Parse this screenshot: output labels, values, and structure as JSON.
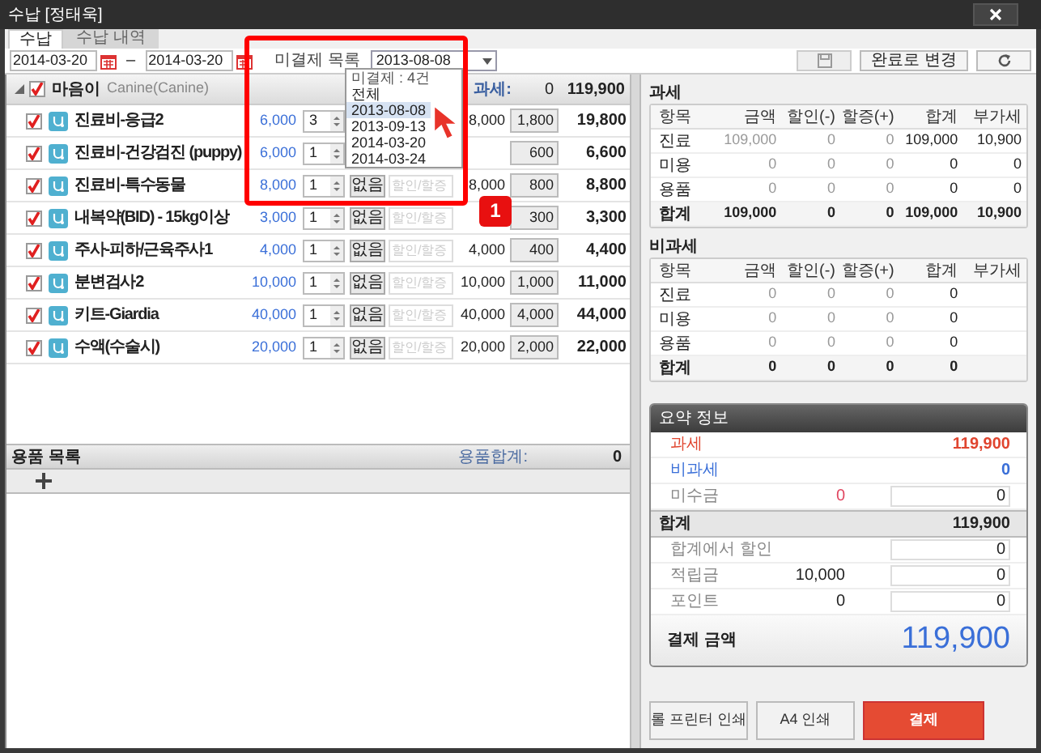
{
  "window": {
    "title": "수납 [정태욱]"
  },
  "tabs": [
    {
      "label": "수납",
      "selected": true
    },
    {
      "label": "수납 내역",
      "selected": false
    }
  ],
  "toolbar": {
    "date_from": "2014-03-20",
    "separator": "–",
    "date_to": "2014-03-20",
    "unpaid_label": "미결제 목록",
    "unpaid_select": "2013-08-08",
    "complete_button": "완료로 변경"
  },
  "dropdown": {
    "options": [
      {
        "label": "미결제 : 4건",
        "kind": "header",
        "selected": false
      },
      {
        "label": "전체",
        "kind": "option",
        "selected": false
      },
      {
        "label": "2013-08-08",
        "kind": "option",
        "selected": true
      },
      {
        "label": "2013-09-13",
        "kind": "option",
        "selected": false
      },
      {
        "label": "2014-03-20",
        "kind": "option",
        "selected": false
      },
      {
        "label": "2014-03-24",
        "kind": "option",
        "selected": false
      }
    ]
  },
  "pet": {
    "checked": true,
    "name": "마음이",
    "species": "Canine(Canine)",
    "tax_label": "과세:",
    "tax_value": "0",
    "total": "119,900"
  },
  "items": [
    {
      "checked": true,
      "name": "진료비-응급2",
      "price": "6,000",
      "qty": "3",
      "amount": "8,000",
      "tax": "1,800",
      "total": "19,800"
    },
    {
      "checked": true,
      "name": "진료비-건강검진 (puppy)",
      "price": "6,000",
      "qty": "1",
      "tax": "600",
      "total": "6,600"
    },
    {
      "checked": true,
      "name": "진료비-특수동물",
      "price": "8,000",
      "qty": "1",
      "discount_button": "없음",
      "discount_placeholder": "할인/할증",
      "amount": "8,000",
      "tax": "800",
      "total": "8,800"
    },
    {
      "checked": true,
      "name": "내복약(BID) - 15kg이상",
      "price": "3,000",
      "qty": "1",
      "discount_button": "없음",
      "discount_placeholder": "할인/할증",
      "tax": "300",
      "total": "3,300"
    },
    {
      "checked": true,
      "name": "주사-피하/근육주사1",
      "price": "4,000",
      "qty": "1",
      "discount_button": "없음",
      "discount_placeholder": "할인/할증",
      "amount": "4,000",
      "tax": "400",
      "total": "4,400"
    },
    {
      "checked": true,
      "name": "분변검사2",
      "price": "10,000",
      "qty": "1",
      "discount_button": "없음",
      "discount_placeholder": "할인/할증",
      "amount": "10,000",
      "tax": "1,000",
      "total": "11,000"
    },
    {
      "checked": true,
      "name": "키트-Giardia",
      "price": "40,000",
      "qty": "1",
      "discount_button": "없음",
      "discount_placeholder": "할인/할증",
      "amount": "40,000",
      "tax": "4,000",
      "total": "44,000"
    },
    {
      "checked": true,
      "name": "수액(수술시)",
      "price": "20,000",
      "qty": "1",
      "discount_button": "없음",
      "discount_placeholder": "할인/할증",
      "amount": "20,000",
      "tax": "2,000",
      "total": "22,000"
    }
  ],
  "supplies": {
    "title": "용품 목록",
    "total_label": "용품합계:",
    "total": "0"
  },
  "tax_tables": [
    {
      "title": "과세",
      "columns": [
        "항목",
        "금액",
        "할인(-)",
        "할증(+)",
        "합계",
        "부가세"
      ],
      "rows": [
        {
          "kind": "item",
          "cells": [
            "진료",
            "109,000",
            "0",
            "0",
            "109,000",
            "10,900"
          ]
        },
        {
          "kind": "item",
          "cells": [
            "미용",
            "0",
            "0",
            "0",
            "0",
            "0"
          ]
        },
        {
          "kind": "item",
          "cells": [
            "용품",
            "0",
            "0",
            "0",
            "0",
            "0"
          ]
        },
        {
          "kind": "total",
          "cells": [
            "합계",
            "109,000",
            "0",
            "0",
            "109,000",
            "10,900"
          ]
        }
      ]
    },
    {
      "title": "비과세",
      "columns": [
        "항목",
        "금액",
        "할인(-)",
        "할증(+)",
        "합계",
        "부가세"
      ],
      "rows": [
        {
          "kind": "item",
          "cells": [
            "진료",
            "0",
            "0",
            "0",
            "0"
          ]
        },
        {
          "kind": "item",
          "cells": [
            "미용",
            "0",
            "0",
            "0",
            "0"
          ]
        },
        {
          "kind": "item",
          "cells": [
            "용품",
            "0",
            "0",
            "0",
            "0"
          ]
        },
        {
          "kind": "total",
          "cells": [
            "합계",
            "0",
            "0",
            "0",
            "0"
          ]
        }
      ]
    }
  ],
  "summary": {
    "title": "요약 정보",
    "rows": [
      {
        "kind": "colored",
        "label": "과세",
        "value": "119,900",
        "color": "#e0452f"
      },
      {
        "kind": "colored",
        "label": "비과세",
        "value": "0",
        "color": "#3a6fd8"
      },
      {
        "kind": "input",
        "label": "미수금",
        "value": "0",
        "input": "0",
        "color": "#e0455f"
      },
      {
        "kind": "total",
        "label": "합계",
        "value": "119,900"
      },
      {
        "kind": "input",
        "label": "합계에서 할인",
        "input": "0"
      },
      {
        "kind": "input",
        "label": "적립금",
        "value": "10,000",
        "input": "0"
      },
      {
        "kind": "input",
        "label": "포인트",
        "value": "0",
        "input": "0"
      }
    ],
    "pay_label": "결제 금액",
    "pay_value": "119,900"
  },
  "buttons": [
    {
      "label": "롤 프린터 인쇄",
      "kind": "plain"
    },
    {
      "label": "A4 인쇄",
      "kind": "plain"
    },
    {
      "label": "결제",
      "kind": "primary"
    }
  ],
  "annotation": {
    "badge": "1"
  }
}
